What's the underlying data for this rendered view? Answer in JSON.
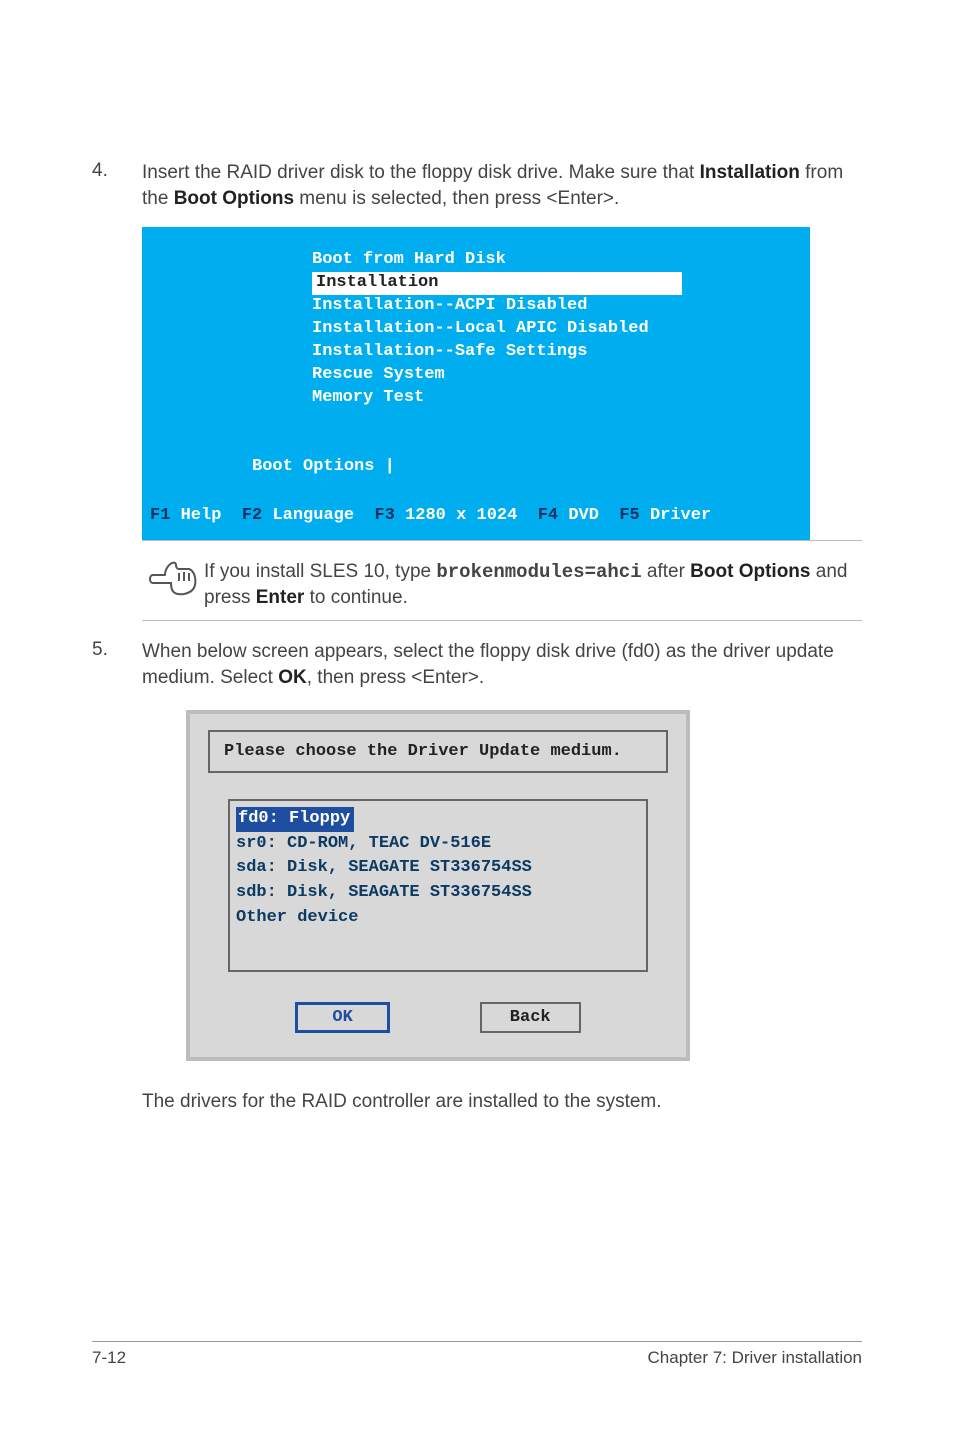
{
  "step4": {
    "num": "4.",
    "text_a": "Insert the RAID driver disk to the floppy disk drive. Make sure that ",
    "bold_a": "Installation",
    "text_b": " from the ",
    "bold_b": "Boot Options",
    "text_c": " menu is selected, then press <Enter>."
  },
  "boot": {
    "lines": {
      "l0": "Boot from Hard Disk",
      "l1": "Installation",
      "l2": "Installation--ACPI Disabled",
      "l3": "Installation--Local APIC Disabled",
      "l4": "Installation--Safe Settings",
      "l5": "Rescue System",
      "l6": "Memory Test"
    },
    "options_label": "Boot Options |",
    "fkeys": {
      "f1": "F1",
      "f1lbl": "Help",
      "f2": "F2",
      "f2lbl": "Language",
      "f3": "F3",
      "f3lbl": "1280 x 1024",
      "f4": "F4",
      "f4lbl": "DVD",
      "f5": "F5",
      "f5lbl": "Driver"
    }
  },
  "note": {
    "t1": "If you install SLES 10, type ",
    "code": "brokenmodules=ahci",
    "t2": " after ",
    "b1": "Boot Options",
    "t3": " and press ",
    "b2": "Enter",
    "t4": " to continue."
  },
  "step5": {
    "num": "5.",
    "text_a": "When below screen appears, select the floppy disk drive (fd0) as the driver update medium. Select ",
    "bold_a": "OK",
    "text_b": ", then press <Enter>."
  },
  "dlg": {
    "title": "Please choose the Driver Update medium.",
    "items": {
      "i0": "fd0: Floppy",
      "i1": "sr0: CD-ROM, TEAC DV-516E",
      "i2": "sda: Disk, SEAGATE ST336754SS",
      "i3": "sdb: Disk, SEAGATE ST336754SS",
      "i4": "Other device"
    },
    "ok": "OK",
    "back": "Back"
  },
  "closing": "The drivers for the RAID controller are installed to the system.",
  "footer": {
    "left": "7-12",
    "right": "Chapter 7: Driver installation"
  }
}
